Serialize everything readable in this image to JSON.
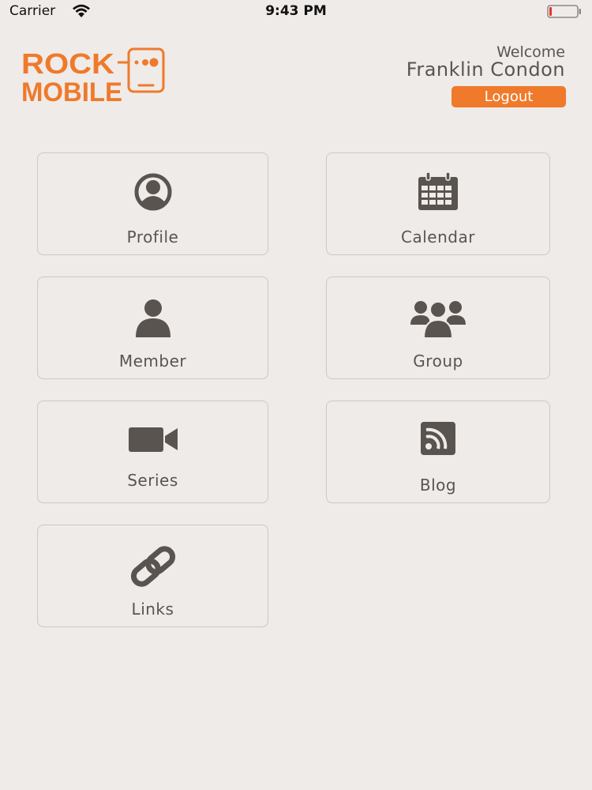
{
  "status_bar": {
    "carrier": "Carrier",
    "time": "9:43 PM",
    "battery_level": 0.1
  },
  "header": {
    "logo": {
      "line1": "ROCK",
      "line2": "MOBILE",
      "icon": "phone-logo-icon"
    },
    "welcome_label": "Welcome",
    "user_name": "Franklin Condon",
    "logout_label": "Logout"
  },
  "menu": {
    "tiles": [
      {
        "label": "Profile",
        "icon": "user-circle-icon"
      },
      {
        "label": "Calendar",
        "icon": "calendar-icon"
      },
      {
        "label": "Member",
        "icon": "user-icon"
      },
      {
        "label": "Group",
        "icon": "users-group-icon"
      },
      {
        "label": "Series",
        "icon": "video-camera-icon"
      },
      {
        "label": "Blog",
        "icon": "rss-icon"
      },
      {
        "label": "Links",
        "icon": "link-icon"
      }
    ]
  },
  "colors": {
    "accent": "#ef7a2c",
    "background": "#efebe8",
    "icon": "#5a5450",
    "tile_border": "#cfc8c3"
  }
}
